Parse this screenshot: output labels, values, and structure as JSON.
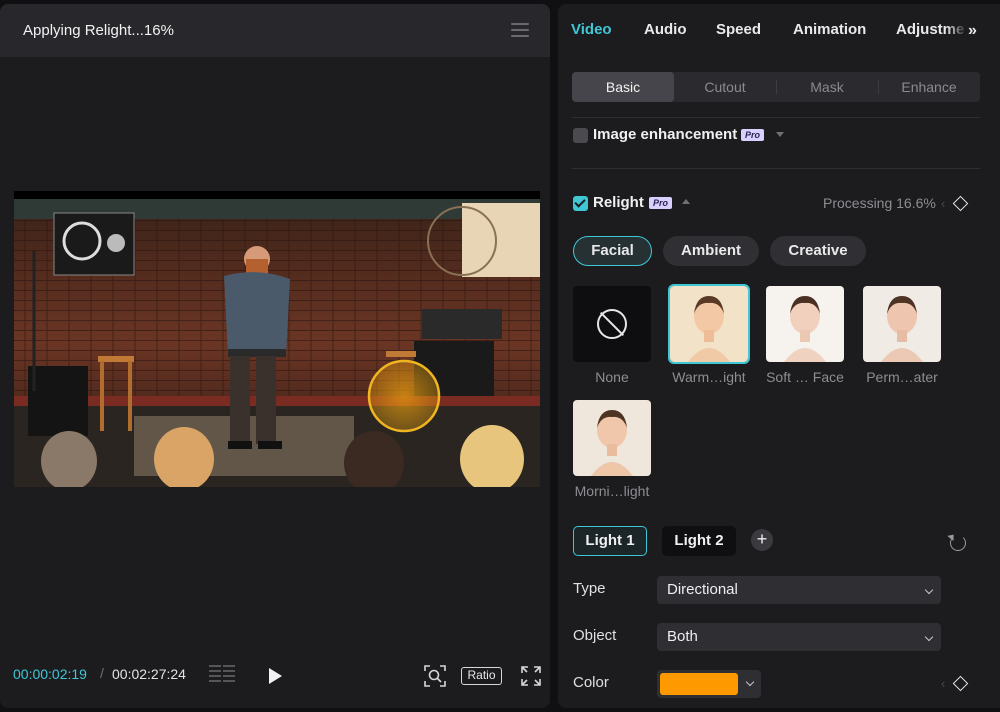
{
  "player": {
    "title": "Applying Relight...16%",
    "current_time": "00:00:02:19",
    "separator": "/",
    "total_time": "00:02:27:24",
    "ratio_label": "Ratio"
  },
  "inspector": {
    "tabs": [
      {
        "label": "Video",
        "active": true
      },
      {
        "label": "Audio"
      },
      {
        "label": "Speed"
      },
      {
        "label": "Animation"
      },
      {
        "label": "Adjustme"
      }
    ],
    "more_tabs_glyph": "»",
    "subtabs": [
      {
        "label": "Basic",
        "active": true
      },
      {
        "label": "Cutout"
      },
      {
        "label": "Mask"
      },
      {
        "label": "Enhance"
      }
    ],
    "image_enhancement": {
      "label": "Image enhancement",
      "badge": "Pro",
      "checked": false
    },
    "relight": {
      "label": "Relight",
      "badge": "Pro",
      "checked": true,
      "status": "Processing 16.6%",
      "modes": [
        {
          "label": "Facial",
          "active": true
        },
        {
          "label": "Ambient"
        },
        {
          "label": "Creative"
        }
      ],
      "presets": [
        {
          "label": "None"
        },
        {
          "label": "Warm…ight",
          "selected": true
        },
        {
          "label": "Soft … Face"
        },
        {
          "label": "Perm…ater"
        },
        {
          "label": "Morni…light"
        }
      ],
      "lights": [
        {
          "label": "Light 1",
          "active": true
        },
        {
          "label": "Light 2"
        }
      ],
      "add_light_glyph": "+",
      "fields": {
        "type_label": "Type",
        "type_value": "Directional",
        "object_label": "Object",
        "object_value": "Both",
        "color_label": "Color",
        "color_value": "#ff9900"
      }
    }
  },
  "colors": {
    "accent": "#3fc7d6",
    "panel": "#1c1c1f"
  }
}
